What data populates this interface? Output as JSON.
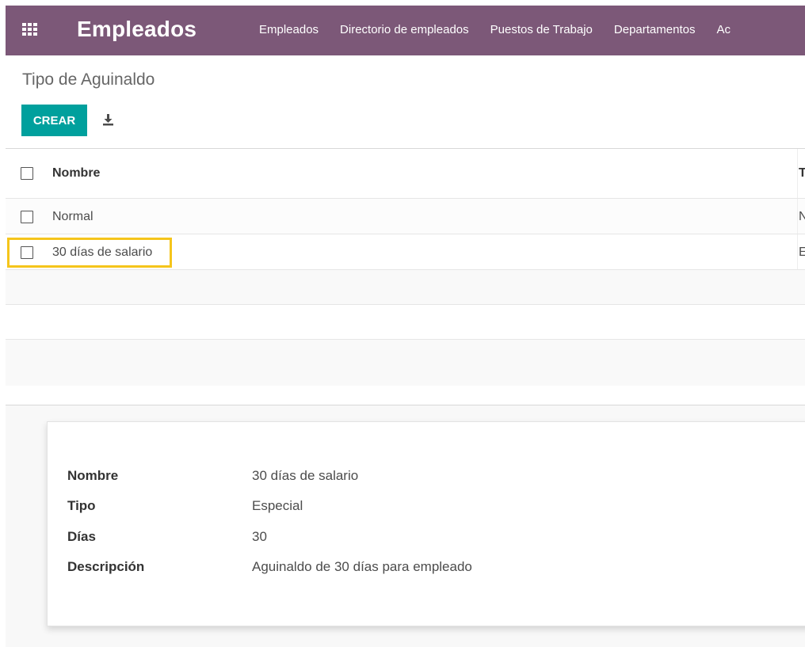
{
  "navbar": {
    "app_name": "Empleados",
    "apps_icon": "apps-grid-icon",
    "background_color": "#7c5878",
    "menu": [
      {
        "label": "Empleados"
      },
      {
        "label": "Directorio de empleados"
      },
      {
        "label": "Puestos de Trabajo"
      },
      {
        "label": "Departamentos"
      },
      {
        "label": "Ac"
      }
    ]
  },
  "page": {
    "title": "Tipo de Aguinaldo"
  },
  "toolbar": {
    "create_label": "CREAR",
    "create_color": "#00a09d",
    "download_icon": "download-icon"
  },
  "list": {
    "columns": {
      "name": "Nombre",
      "tipo": "T"
    },
    "rows": [
      {
        "name": "Normal",
        "tipo": "N"
      },
      {
        "name": "30 días de salario",
        "tipo": "E"
      }
    ],
    "highlight_color": "#f5c51b"
  },
  "form": {
    "fields": [
      {
        "label": "Nombre",
        "value": "30 días de salario"
      },
      {
        "label": "Tipo",
        "value": "Especial"
      },
      {
        "label": "Días",
        "value": "30"
      },
      {
        "label": "Descripción",
        "value": "Aguinaldo de 30 días para empleado"
      }
    ]
  }
}
